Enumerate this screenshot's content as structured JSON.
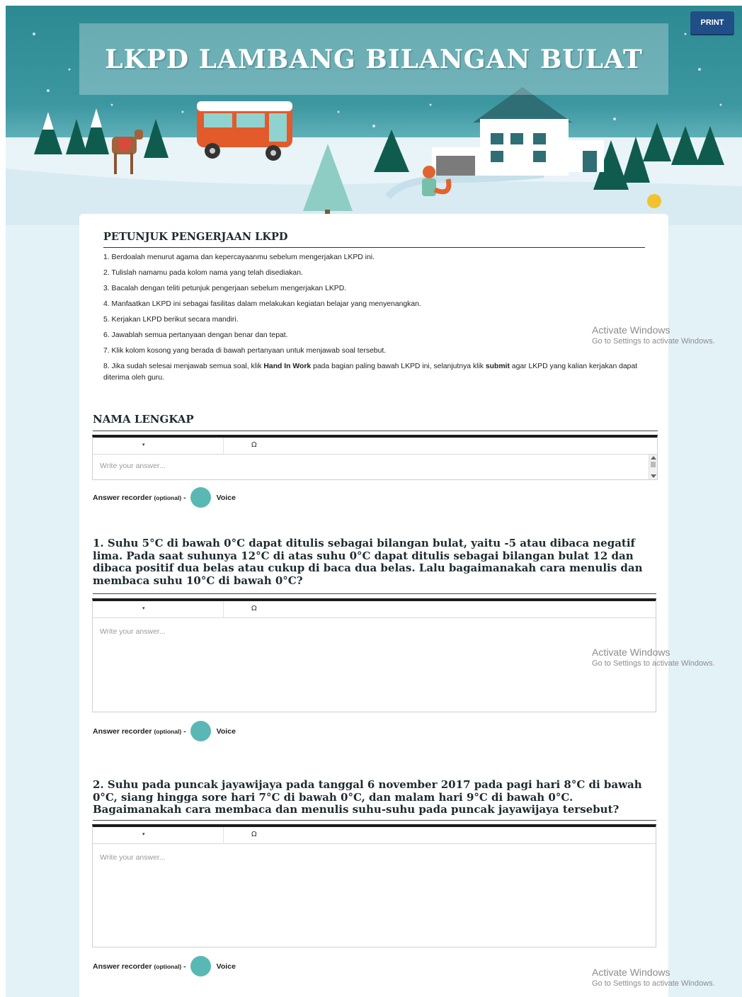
{
  "header": {
    "title": "LKPD LAMBANG BILANGAN BULAT",
    "print_label": "PRINT"
  },
  "instructions": {
    "title": "PETUNJUK PENGERJAAN LKPD",
    "items": [
      "1. Berdoalah menurut agama dan kepercayaanmu sebelum mengerjakan LKPD ini.",
      "2. Tulislah namamu pada kolom nama yang telah disediakan.",
      "3. Bacalah dengan teliti petunjuk pengerjaan sebelum mengerjakan LKPD.",
      "4. Manfaatkan LKPD ini sebagai fasilitas dalam melakukan kegiatan belajar yang menyenangkan.",
      "5. Kerjakan LKPD berikut secara mandiri.",
      "6. Jawablah semua pertanyaan dengan benar dan tepat.",
      "7. Klik kolom kosong yang berada di bawah pertanyaan untuk menjawab soal tersebut."
    ],
    "item8": {
      "part1": "8. Jika sudah selesai menjawab semua soal, klik ",
      "bold1": "Hand In Work",
      "part2": " pada bagian paling bawah LKPD ini, selanjutnya klik ",
      "bold2": "submit",
      "part3": " agar LKPD yang kalian kerjakan dapat diterima oleh guru."
    }
  },
  "name_section": {
    "title": "NAMA LENGKAP"
  },
  "questions": [
    {
      "text": "1. Suhu 5°C di bawah 0°C dapat ditulis sebagai bilangan bulat, yaitu -5 atau dibaca negatif lima. Pada saat suhunya 12°C di atas suhu 0°C dapat ditulis sebagai bilangan bulat 12 dan dibaca positif dua belas atau cukup di baca dua belas. Lalu bagaimanakah cara menulis dan membaca suhu 10°C di bawah 0°C?"
    },
    {
      "text": "2. Suhu pada puncak jayawijaya pada tanggal 6 november 2017 pada pagi hari 8°C di bawah 0°C, siang hingga sore hari 7°C di bawah 0°C, dan malam hari 9°C di bawah 0°C. Bagaimanakah cara membaca dan menulis suhu-suhu pada puncak jayawijaya tersebut?"
    }
  ],
  "editor": {
    "dropdown_glyph": "▾",
    "omega_glyph": "Ω",
    "placeholder": "Write your answer..."
  },
  "recorder": {
    "label": "Answer recorder",
    "optional": "(optional)",
    "dash": "-",
    "voice_label": "Voice"
  },
  "watermark": {
    "title": "Activate Windows",
    "subtitle": "Go to Settings to activate Windows."
  },
  "colors": {
    "banner_teal": "#2d8a92",
    "page_bg": "#e3f2f7",
    "print_button": "#1f4f86",
    "voice_button": "#5ab8b4"
  }
}
